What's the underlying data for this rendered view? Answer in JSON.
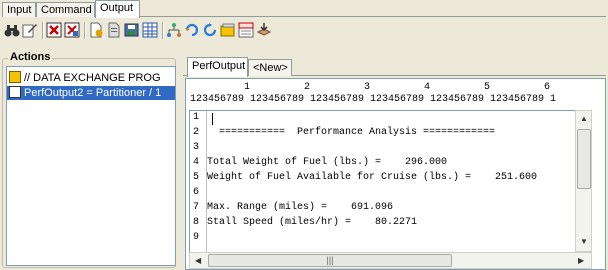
{
  "top_tabs": [
    "Input",
    "Command",
    "Output"
  ],
  "toolbar": {
    "icons": [
      "binoculars-icon",
      "edit-icon",
      "delete-red-icon",
      "delete-all-icon",
      "new-doc-icon",
      "doc-icon",
      "save-doc-icon",
      "table-icon",
      "tree-icon",
      "refresh-icon",
      "reload-icon",
      "note-icon",
      "jeeva-icon",
      "export-icon"
    ]
  },
  "actions": {
    "title": "Actions",
    "items": [
      {
        "label": "// DATA EXCHANGE PROG",
        "selected": false
      },
      {
        "label": "PerfOutput2 = Partitioner / 1",
        "selected": true
      }
    ]
  },
  "output_tabs": [
    "PerfOutput",
    "<New>"
  ],
  "editor": {
    "ruler_numbers": "         1         2         3         4         5         6",
    "ruler_digits": "123456789 123456789 123456789 123456789 123456789 123456789 1",
    "lines": [
      {
        "n": "1",
        "text": ""
      },
      {
        "n": "2",
        "text": "  ===========  Performance Analysis ============"
      },
      {
        "n": "3",
        "text": ""
      },
      {
        "n": "4",
        "text": "Total Weight of Fuel (lbs.) =    296.000"
      },
      {
        "n": "5",
        "text": "Weight of Fuel Available for Cruise (lbs.) =    251.600"
      },
      {
        "n": "6",
        "text": ""
      },
      {
        "n": "7",
        "text": "Max. Range (miles) =    691.096"
      },
      {
        "n": "8",
        "text": "Stall Speed (miles/hr) =    80.2271"
      },
      {
        "n": "9",
        "text": ""
      }
    ]
  }
}
